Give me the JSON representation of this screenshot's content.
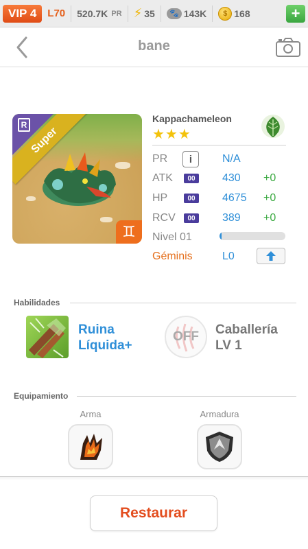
{
  "status_bar": {
    "vip": "VIP 4",
    "level": "L70",
    "pr_value": "520.7K",
    "pr_unit": "PR",
    "energy": "35",
    "food": "143K",
    "coins": "168",
    "add_label": "+"
  },
  "header": {
    "title": "bane"
  },
  "monster": {
    "name": "Kappachameleon",
    "stars": "★★★",
    "grade": "Super",
    "rarity_icon": "R",
    "element_icon": "leaf-icon",
    "zodiac_icon": "gemini-icon",
    "zodiac_glyph": "♊",
    "accent_color": "#e5701e",
    "stats": {
      "pr_label": "PR",
      "pr_value": "N/A",
      "info_label": "i",
      "atk_label": "ATK",
      "atk_badge": "00",
      "atk_value": "430",
      "atk_bonus": "+0",
      "hp_label": "HP",
      "hp_badge": "00",
      "hp_value": "4675",
      "hp_bonus": "+0",
      "rcv_label": "RCV",
      "rcv_badge": "00",
      "rcv_value": "389",
      "rcv_bonus": "+0",
      "level_label": "Nivel 01",
      "level_progress": 0.03,
      "sign_label": "Géminis",
      "sign_level": "L0"
    }
  },
  "skills": {
    "section_title": "Habilidades",
    "active_name": "Ruina Líquida+",
    "leader_status": "OFF",
    "leader_name": "Caballería LV 1"
  },
  "equipment": {
    "section_title": "Equipamiento",
    "weapon_label": "Arma",
    "armor_label": "Armadura"
  },
  "footer": {
    "restore_label": "Restaurar"
  }
}
